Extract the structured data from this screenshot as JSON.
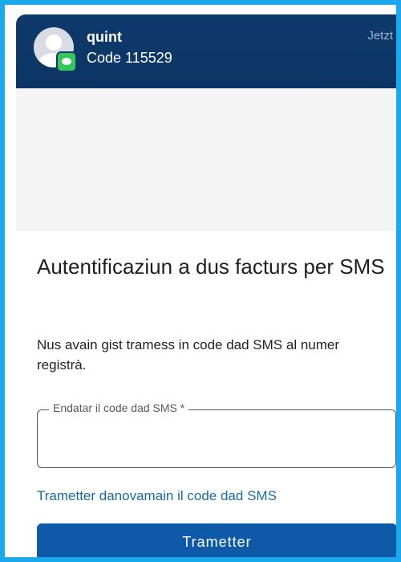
{
  "notification": {
    "sender": "quint",
    "preview": "Code 115529",
    "time": "Jetzt",
    "app_icon": "messages-icon",
    "avatar_icon": "person-icon"
  },
  "form": {
    "title": "Autentificaziun a dus facturs per SMS",
    "description": "Nus avain gist tramess in code dad SMS al numer registrà.",
    "field_label": "Endatar il code dad SMS *",
    "field_value": "",
    "resend_link": "Trametter danovamain il code dad SMS",
    "submit_label": "Trametter"
  },
  "colors": {
    "frame_border": "#1ca8ec",
    "header_bg": "#0e3a6b",
    "primary_button": "#0f5aa8",
    "link": "#1769aa",
    "badge_green": "#34c759"
  }
}
